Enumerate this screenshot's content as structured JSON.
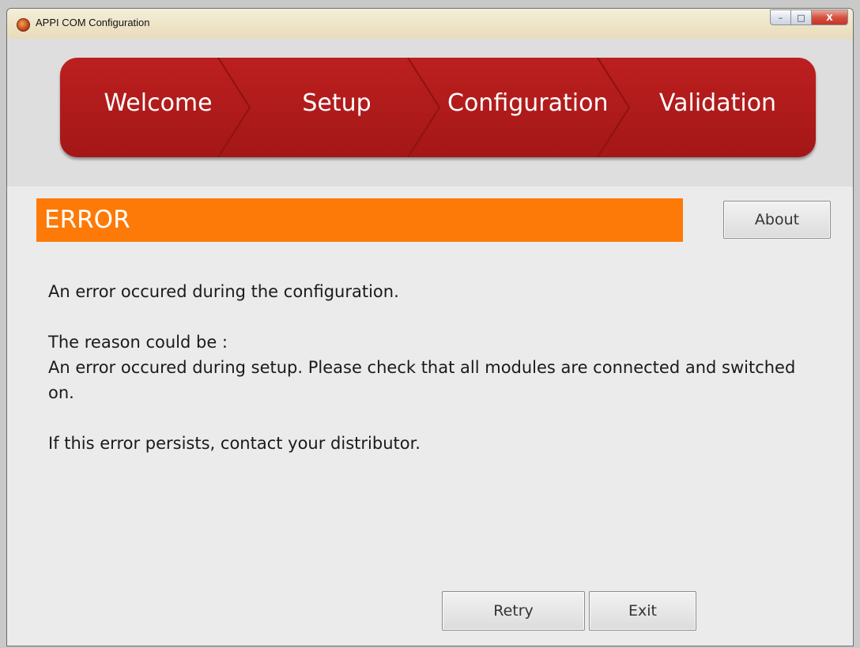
{
  "window": {
    "title": "APPI COM Configuration",
    "controls": {
      "minimize": "–",
      "maximize": "□",
      "close": "X"
    }
  },
  "steps": [
    "Welcome",
    "Setup",
    "Configuration",
    "Validation"
  ],
  "error": {
    "title": "ERROR"
  },
  "buttons": {
    "about": "About",
    "retry": "Retry",
    "exit": "Exit"
  },
  "message": {
    "line1": "An error occured during the configuration.",
    "reason_label": "The reason could be :",
    "reason_text": "An error occured during setup. Please check that all modules are connected and switched on.",
    "contact": "If this error persists, contact your distributor."
  },
  "colors": {
    "step_bar": "#b21c1c",
    "error_bar": "#fd7a08",
    "window_bg": "#ebebeb"
  },
  "icons": {
    "app": "app-logo-icon"
  }
}
